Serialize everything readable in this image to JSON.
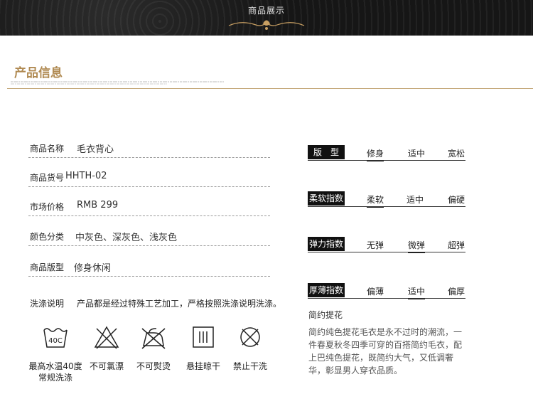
{
  "banner": {
    "title": "商品展示"
  },
  "section": {
    "title": "产品信息"
  },
  "info": {
    "name_label": "商品名称",
    "name_value": "毛衣背心",
    "code_label": "商品货号",
    "code_value": "HHTH-02",
    "price_label": "市场价格",
    "price_value": "RMB 299",
    "color_label": "颜色分类",
    "color_value": "中灰色、深灰色、浅灰色",
    "fit_label": "商品版型",
    "fit_value": "修身休闲",
    "wash_label": "洗涤说明",
    "wash_value": "产品都是经过特殊工艺加工，严格按照洗涤说明洗涤。"
  },
  "care": [
    {
      "icon": "wash-40-icon",
      "line1": "最高水温40度",
      "line2": "常规洗涤",
      "tub_text": "40C"
    },
    {
      "icon": "no-bleach-icon",
      "line1": "不可氯漂",
      "line2": ""
    },
    {
      "icon": "no-iron-icon",
      "line1": "不可熨烫",
      "line2": ""
    },
    {
      "icon": "hang-dry-icon",
      "line1": "悬挂晾干",
      "line2": ""
    },
    {
      "icon": "no-dry-clean-icon",
      "line1": "禁止干洗",
      "line2": ""
    }
  ],
  "attributes": [
    {
      "label": "版　型",
      "options": [
        "修身",
        "适中",
        "宽松"
      ],
      "selected_index": 0
    },
    {
      "label": "柔软指数",
      "options": [
        "柔软",
        "适中",
        "偏硬"
      ],
      "selected_index": 0
    },
    {
      "label": "弹力指数",
      "options": [
        "无弹",
        "微弹",
        "超弹"
      ],
      "selected_index": 1
    },
    {
      "label": "厚薄指数",
      "options": [
        "偏薄",
        "适中",
        "偏厚"
      ],
      "selected_index": 1
    }
  ],
  "description": {
    "title": "简约提花",
    "text": "简约纯色提花毛衣是永不过时的潮流，一件春夏秋冬四季可穿的百搭简约毛衣，配上巴纯色提花，既简约大气，又低调奢华，彰显男人穿衣品质。"
  },
  "colors": {
    "accent": "#b08a52",
    "line": "#c2a676",
    "badge": "#111111"
  }
}
